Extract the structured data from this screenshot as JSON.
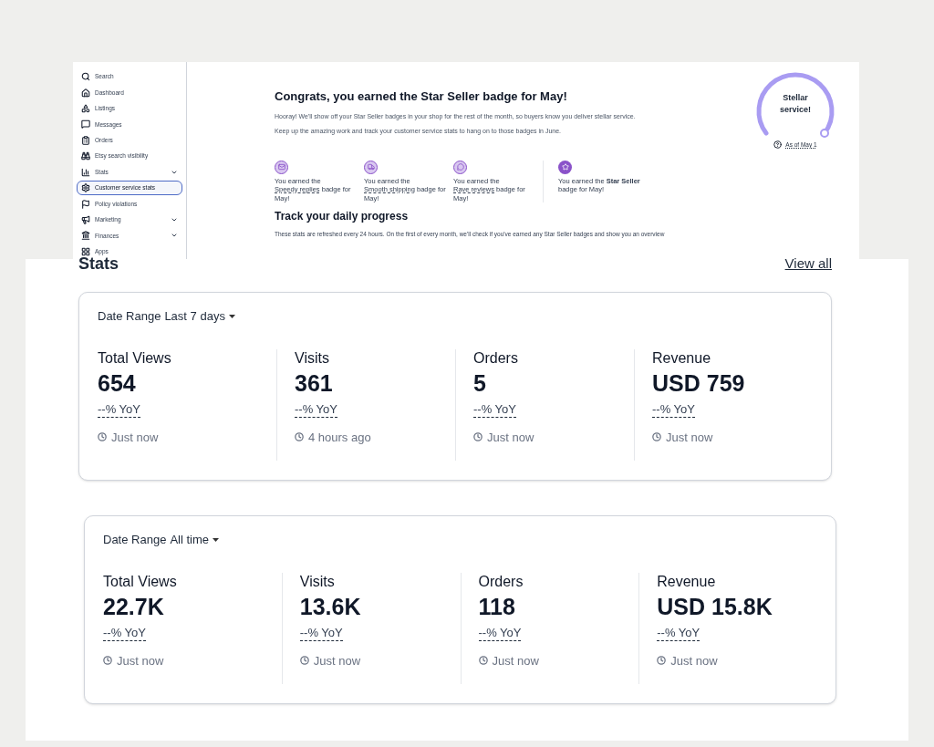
{
  "sidebar": {
    "items": [
      {
        "label": "Search",
        "selected": false,
        "has_submenu": false
      },
      {
        "label": "Dashboard",
        "selected": false,
        "has_submenu": false
      },
      {
        "label": "Listings",
        "selected": false,
        "has_submenu": false
      },
      {
        "label": "Messages",
        "selected": false,
        "has_submenu": false
      },
      {
        "label": "Orders",
        "selected": false,
        "has_submenu": false
      },
      {
        "label": "Etsy search visibility",
        "selected": false,
        "has_submenu": false
      },
      {
        "label": "Stats",
        "selected": false,
        "has_submenu": true
      },
      {
        "label": "Customer service stats",
        "selected": true,
        "has_submenu": false
      },
      {
        "label": "Policy violations",
        "selected": false,
        "has_submenu": false
      },
      {
        "label": "Marketing",
        "selected": false,
        "has_submenu": true
      },
      {
        "label": "Finances",
        "selected": false,
        "has_submenu": true
      },
      {
        "label": "Apps",
        "selected": false,
        "has_submenu": false
      }
    ]
  },
  "banner": {
    "title": "Congrats, you earned the Star Seller badge for May!",
    "paragraphs": [
      "Hooray! We'll show off your Star Seller badges in your shop for the rest of the month, so buyers know you deliver stellar service.",
      "Keep up the amazing work and track your customer service stats to hang on to those badges in June."
    ],
    "gauge": {
      "label": "Stellar service!",
      "as_of": "As of May 1"
    },
    "badges": [
      {
        "kind": "link",
        "prefix": "You earned the",
        "link": "Speedy replies",
        "suffix": "badge for May!"
      },
      {
        "kind": "link",
        "prefix": "You earned the",
        "link": "Smooth shipping",
        "suffix": "badge for May!"
      },
      {
        "kind": "link",
        "prefix": "You earned the",
        "link": "Rave reviews",
        "suffix": "badge for May!"
      },
      {
        "kind": "star",
        "text": "You earned the **Star Seller** badge for May!"
      }
    ],
    "progress_title": "Track your daily progress",
    "progress_text": "These stats are refreshed every 24 hours. On the first of every month, we'll check if you've earned any Star Seller badges and show you an overview"
  },
  "stats": {
    "title": "Stats",
    "view_all": "View all",
    "cards": [
      {
        "date_range_label": "Date Range",
        "date_range": "Last 7 days",
        "metrics": [
          {
            "label": "Total Views",
            "value": "654",
            "yoy": "--% YoY",
            "updated": "Just now"
          },
          {
            "label": "Visits",
            "value": "361",
            "yoy": "--% YoY",
            "updated": "4 hours ago"
          },
          {
            "label": "Orders",
            "value": "5",
            "yoy": "--% YoY",
            "updated": "Just now"
          },
          {
            "label": "Revenue",
            "value": "USD 759",
            "yoy": "--% YoY",
            "updated": "Just now"
          }
        ]
      },
      {
        "date_range_label": "Date Range",
        "date_range": "All time",
        "metrics": [
          {
            "label": "Total Views",
            "value": "22.7K",
            "yoy": "--% YoY",
            "updated": "Just now"
          },
          {
            "label": "Visits",
            "value": "13.6K",
            "yoy": "--% YoY",
            "updated": "Just now"
          },
          {
            "label": "Orders",
            "value": "118",
            "yoy": "--% YoY",
            "updated": "Just now"
          },
          {
            "label": "Revenue",
            "value": "USD 15.8K",
            "yoy": "--% YoY",
            "updated": "Just now"
          }
        ]
      }
    ]
  }
}
